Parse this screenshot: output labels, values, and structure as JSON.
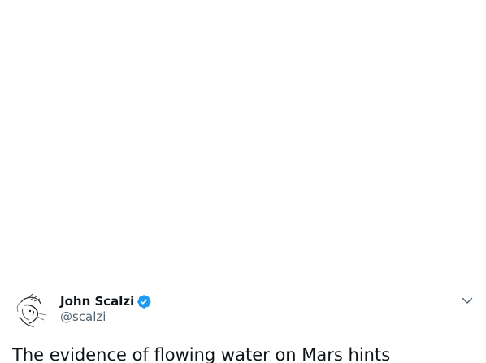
{
  "tweet": {
    "author": {
      "display_name": "John Scalzi",
      "handle": "@scalzi",
      "verified": true,
      "avatar_icon": "ink-sketch-avatar-icon",
      "verified_icon": "verified-badge-icon"
    },
    "menu_icon": "chevron-down-icon",
    "text": "The evidence of flowing water on Mars hints",
    "colors": {
      "text": "#0f1419",
      "handle": "#536471",
      "verified": "#1d9bf0"
    }
  }
}
